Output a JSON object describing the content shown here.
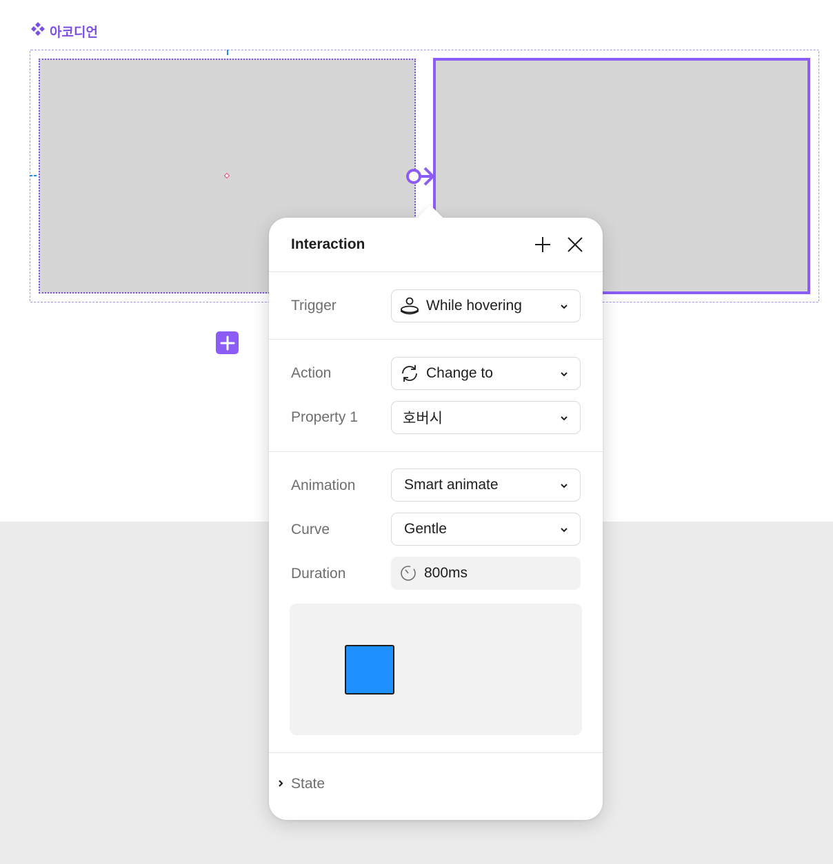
{
  "canvas": {
    "component_name": "아코디언",
    "accent_color": "#8b5cf6",
    "variant_fill": "#d6d6d6"
  },
  "panel": {
    "title": "Interaction",
    "add_icon": "plus-icon",
    "close_icon": "close-icon",
    "trigger": {
      "label": "Trigger",
      "value": "While hovering",
      "icon": "hover-icon"
    },
    "action": {
      "label": "Action",
      "value": "Change to",
      "icon": "change-to-icon"
    },
    "property": {
      "label": "Property 1",
      "value": "호버시"
    },
    "animation": {
      "label": "Animation",
      "value": "Smart animate"
    },
    "curve": {
      "label": "Curve",
      "value": "Gentle"
    },
    "duration": {
      "label": "Duration",
      "value": "800ms",
      "icon": "timer-icon"
    },
    "preview": {
      "box_color": "#1e90ff"
    },
    "state": {
      "label": "State"
    }
  }
}
